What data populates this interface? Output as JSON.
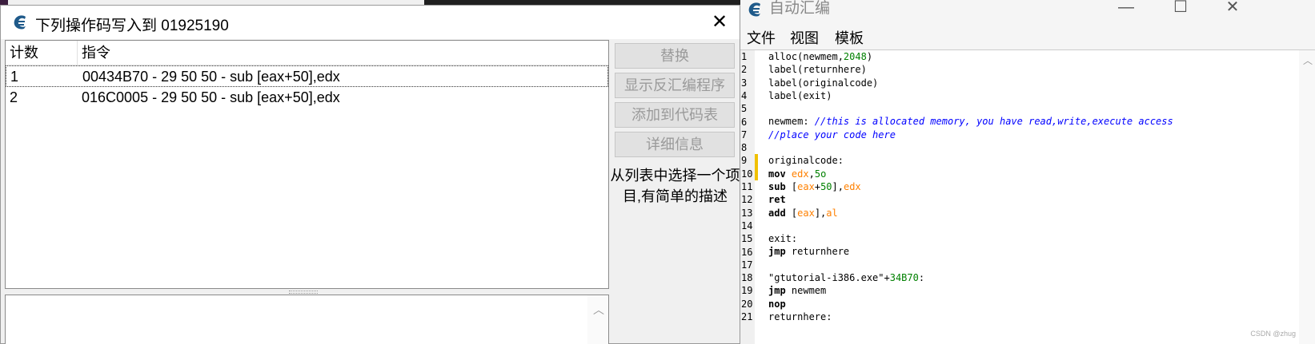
{
  "dialog": {
    "title": "下列操作码写入到 01925190",
    "close_glyph": "✕",
    "columns": [
      "计数",
      "指令"
    ],
    "rows": [
      {
        "count": "1",
        "instruction": "00434B70 - 29 50 50  - sub [eax+50],edx"
      },
      {
        "count": "2",
        "instruction": "016C0005 - 29 50 50  - sub [eax+50],edx"
      }
    ],
    "buttons": {
      "replace": "替换",
      "show_disassembler": "显示反汇编程序",
      "add_to_codelist": "添加到代码表",
      "details": "详细信息"
    },
    "hint": "从列表中选择一个项目,有简单的描述"
  },
  "autoassemble": {
    "title": "自动汇编",
    "window_controls": {
      "minimize": "—",
      "maximize": "☐",
      "close": "✕"
    },
    "menu": [
      "文件",
      "视图",
      "模板"
    ],
    "line_numbers": [
      "1",
      "2",
      "3",
      "4",
      "5",
      "6",
      "7",
      "8",
      "9",
      "10",
      "11",
      "12",
      "13",
      "14",
      "15",
      "16",
      "17",
      "18",
      "19",
      "20",
      "21"
    ],
    "code_lines": [
      "alloc(newmem,2048)",
      "label(returnhere)",
      "label(originalcode)",
      "label(exit)",
      "",
      "newmem: //this is allocated memory, you have read,write,execute access",
      "//place your code here",
      "",
      "originalcode:",
      "mov edx,5o",
      "sub [eax+50],edx",
      "ret",
      "add [eax],al",
      "",
      "exit:",
      "jmp returnhere",
      "",
      "\"gtutorial-i386.exe\"+34B70:",
      "jmp newmem",
      "nop",
      "returnhere:"
    ],
    "watermark": "CSDN @zhug"
  },
  "colors": {
    "comment": "#0000ff",
    "number": "#008000",
    "register": "#ff8000",
    "gutter_mark": "#f0c000"
  },
  "icons": {
    "app_logo": "cheat-engine-logo-icon"
  }
}
